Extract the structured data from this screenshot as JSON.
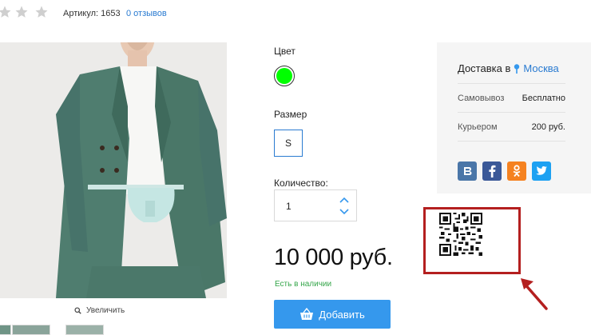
{
  "rating": {
    "stars": 0,
    "max": 5
  },
  "sku": {
    "text": "Артикул: 1653"
  },
  "reviews": {
    "text": "0 отзывов"
  },
  "gallery": {
    "zoom_label": "Увеличить"
  },
  "options": {
    "color_label": "Цвет",
    "color_value": "#00ff00",
    "size_label": "Размер",
    "size_value": "S",
    "quantity_label": "Количество:",
    "quantity_value": "1"
  },
  "price": {
    "text": "10 000 руб."
  },
  "stock": {
    "text": "Есть в наличии"
  },
  "add_button": {
    "label": "Добавить"
  },
  "delivery": {
    "title": "Доставка в",
    "city": "Москва",
    "rows": [
      {
        "label": "Самовывоз",
        "value": "Бесплатно"
      },
      {
        "label": "Курьером",
        "value": "200 руб."
      }
    ]
  },
  "social": [
    {
      "name": "vk-icon",
      "glyph": "В",
      "color": "#4a76a8"
    },
    {
      "name": "facebook-icon",
      "glyph": "f",
      "color": "#3b5998"
    },
    {
      "name": "odnoklassniki-icon",
      "glyph": "ок",
      "color": "#f58220"
    },
    {
      "name": "twitter-icon",
      "glyph": "t",
      "color": "#1da1f2"
    }
  ],
  "colors": {
    "accent": "#3598ed",
    "link": "#2a7bd1",
    "stock": "#35a64a",
    "highlight": "#b41f1f"
  }
}
